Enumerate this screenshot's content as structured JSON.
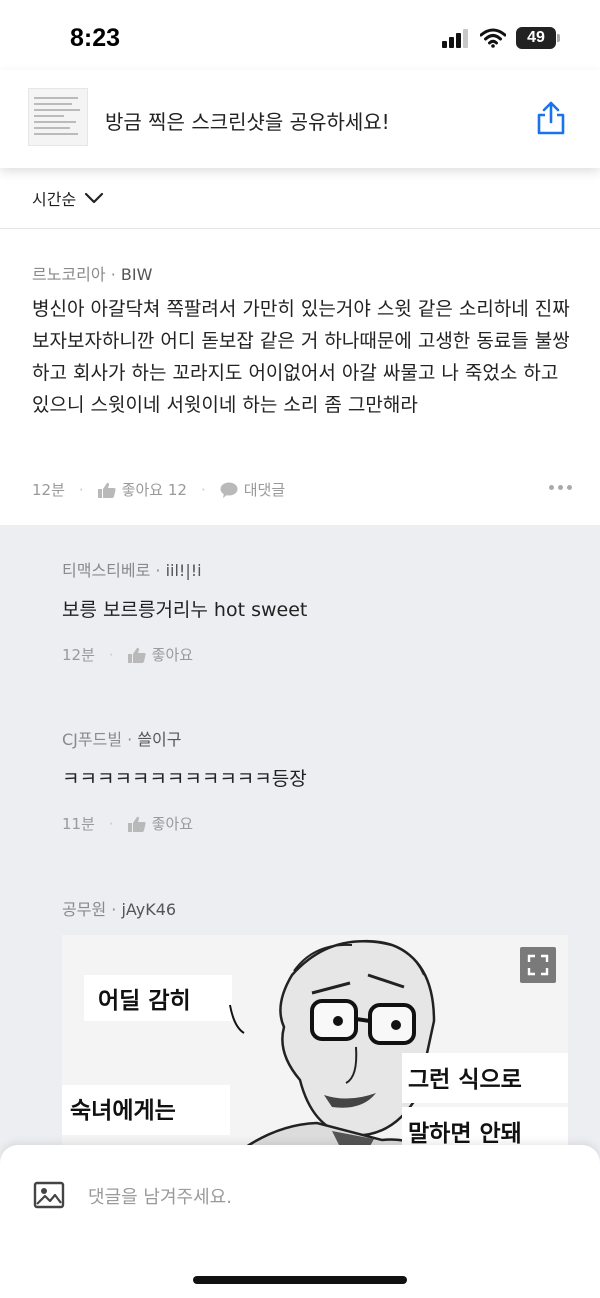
{
  "status_bar": {
    "time": "8:23",
    "battery": "49"
  },
  "share_banner": {
    "title": "방금 찍은 스크린샷을 공유하세요!"
  },
  "sort": {
    "label": "시간순"
  },
  "main_comment": {
    "nickname": "르노코리아",
    "user_id": "BIW",
    "text": "병신아 아갈닥쳐 쪽팔려서 가만히 있는거야 스윗 같은 소리하네 진짜 보자보자하니깐 어디 돋보잡 같은 거 하나때문에 고생한 동료들 불쌍하고 회사가 하는 꼬라지도 어이없어서 아갈 싸물고 나 죽었소 하고 있으니 스윗이네 서윗이네 하는 소리 좀 그만해라",
    "time": "12분",
    "like_label": "좋아요 12",
    "reply_label": "대댓글"
  },
  "replies": [
    {
      "nickname": "티맥스티베로",
      "user_id": "iil!|!i",
      "text": "보릉 보르릉거리누 hot sweet",
      "time": "12분",
      "like_label": "좋아요"
    },
    {
      "nickname": "CJ푸드빌",
      "user_id": "쓸이구",
      "text": "ㅋㅋㅋㅋㅋㅋㅋㅋㅋㅋㅋㅋ등장",
      "time": "11분",
      "like_label": "좋아요"
    },
    {
      "nickname": "공무원",
      "user_id": "jAyK46"
    }
  ],
  "meme": {
    "line_1": "어딜 감히",
    "line_2": "숙녀에게는",
    "line_3": "그런 식으로",
    "line_4": "말하면 안돼"
  },
  "composer": {
    "placeholder": "댓글을 남겨주세요."
  },
  "colors": {
    "accent": "#1a73e8",
    "reply_bg": "#eceef2",
    "meta": "#8a8a8a"
  }
}
